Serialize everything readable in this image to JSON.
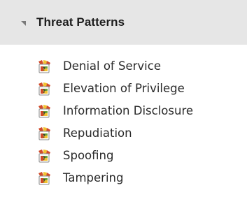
{
  "group": {
    "title": "Threat Patterns",
    "expanded": true
  },
  "items": [
    {
      "label": "Denial of Service",
      "icon": "threat-pattern-icon"
    },
    {
      "label": "Elevation of Privilege",
      "icon": "threat-pattern-icon"
    },
    {
      "label": "Information Disclosure",
      "icon": "threat-pattern-icon"
    },
    {
      "label": "Repudiation",
      "icon": "threat-pattern-icon"
    },
    {
      "label": "Spoofing",
      "icon": "threat-pattern-icon"
    },
    {
      "label": "Tampering",
      "icon": "threat-pattern-icon"
    }
  ],
  "colors": {
    "header_bg": "#e6e6e6",
    "icon_red": "#d04a2a",
    "icon_yellow": "#f2c230",
    "icon_green": "#6fa53a"
  }
}
